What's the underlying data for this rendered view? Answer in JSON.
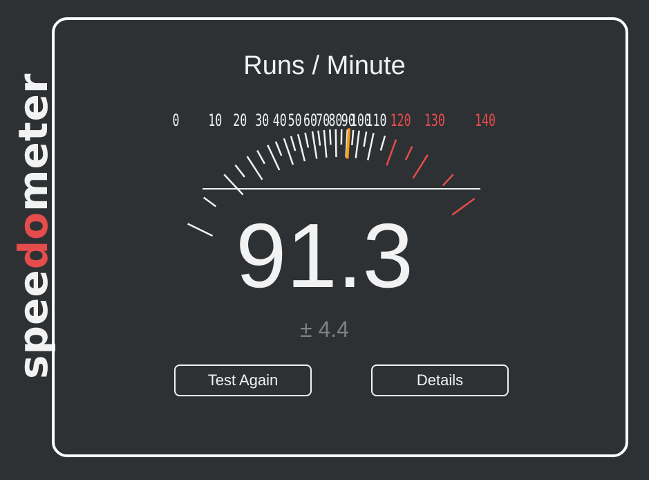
{
  "brand": {
    "prefix": "spee",
    "highlight": "do",
    "suffix": "meter",
    "color": "#f2f2f2",
    "highlight_color": "#e54c4c"
  },
  "gauge": {
    "title": "Runs / Minute",
    "min": 0,
    "max": 140,
    "ticks": [
      "0",
      "10",
      "20",
      "30",
      "40",
      "50",
      "60",
      "70",
      "80",
      "90",
      "100",
      "110",
      "120",
      "130",
      "140"
    ],
    "red_zone_start": 120,
    "needle_value": 91.3,
    "normal_color": "#f2f2f2",
    "red_color": "#e54c4c",
    "needle_color": "#f59e1e"
  },
  "result": {
    "score": "91.3",
    "error": "± 4.4"
  },
  "buttons": {
    "test_again": "Test Again",
    "details": "Details"
  }
}
